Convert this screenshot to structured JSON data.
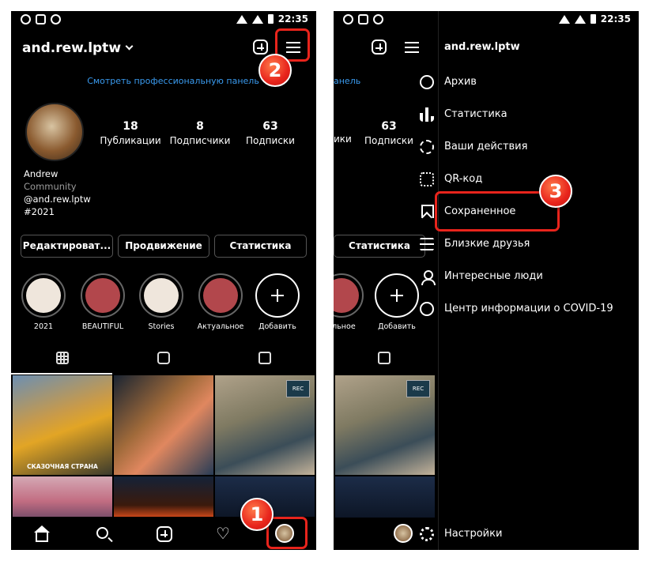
{
  "status": {
    "time": "22:35"
  },
  "left": {
    "username": "and.rew.lptw",
    "pro_link": "Смотреть профессиональную панель",
    "stats": [
      {
        "value": "18",
        "label": "Публикации"
      },
      {
        "value": "8",
        "label": "Подписчики"
      },
      {
        "value": "63",
        "label": "Подписки"
      }
    ],
    "bio": {
      "name": "Andrew",
      "category": "Community",
      "handle": "@and.rew.lptw",
      "tag": "#2021"
    },
    "buttons": {
      "edit": "Редактироват...",
      "promo": "Продвижение",
      "stats": "Статистика"
    },
    "highlights": [
      "2021",
      "BEAUTIFUL",
      "Stories",
      "Актуальное",
      "Добавить"
    ],
    "tile_caption": "СКАЗОЧНАЯ СТРАНА",
    "badges": {
      "one": "1",
      "two": "2"
    }
  },
  "right": {
    "username": "and.rew.lptw",
    "pro_link_fragment": "анель",
    "stat_partial": {
      "value": "63",
      "label_left": "ики",
      "label": "Подписки"
    },
    "button_stats": "Статистика",
    "highlights": [
      "альное",
      "Добавить"
    ],
    "menu": [
      {
        "label": "Архив",
        "icon": "archive-icon"
      },
      {
        "label": "Статистика",
        "icon": "insights-icon"
      },
      {
        "label": "Ваши действия",
        "icon": "activity-icon"
      },
      {
        "label": "QR-код",
        "icon": "qr-code-icon"
      },
      {
        "label": "Сохраненное",
        "icon": "bookmark-icon"
      },
      {
        "label": "Близкие друзья",
        "icon": "close-friends-icon"
      },
      {
        "label": "Интересные люди",
        "icon": "discover-people-icon"
      },
      {
        "label": "Центр информации о COVID-19",
        "icon": "covid-info-icon"
      }
    ],
    "settings": "Настройки",
    "badge_three": "3"
  },
  "colors": {
    "accent_red": "#e8241c",
    "link_blue": "#3a9bf0",
    "background": "#000000"
  }
}
